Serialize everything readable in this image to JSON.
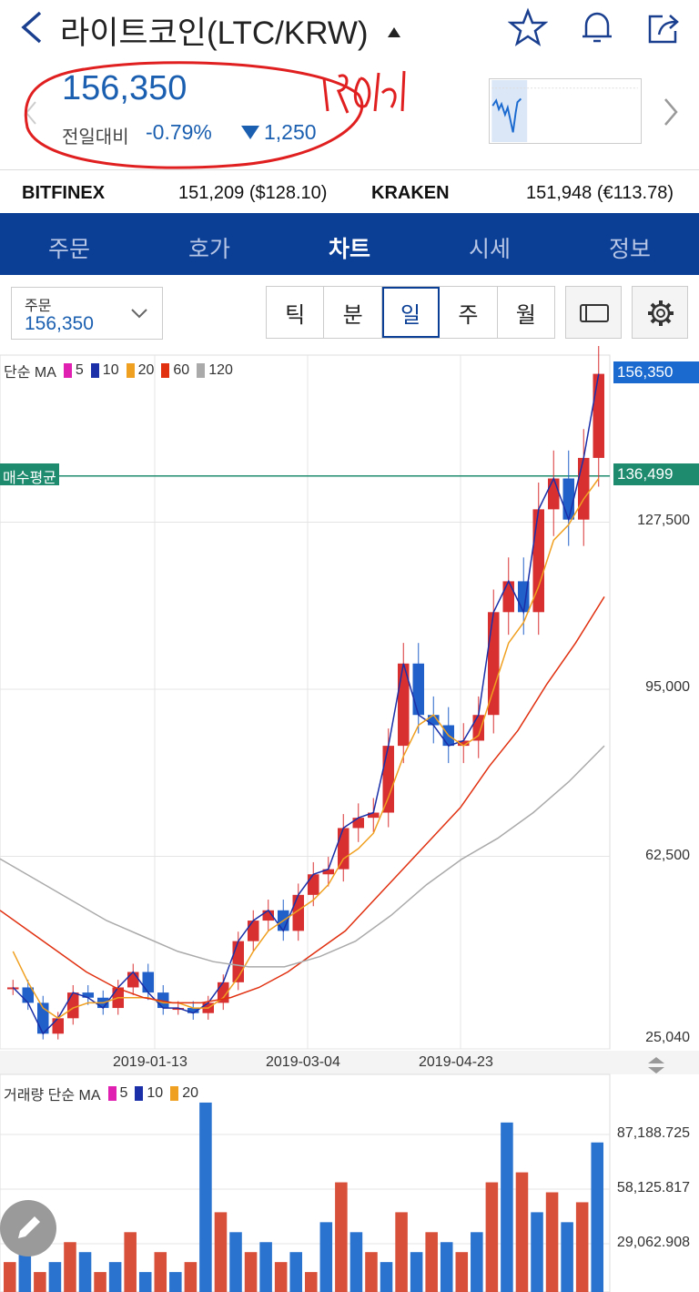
{
  "header": {
    "title": "라이트코인(LTC/KRW)",
    "icons": [
      "back-icon",
      "dropdown-caret-icon",
      "star-icon",
      "bell-icon",
      "share-icon"
    ]
  },
  "price": {
    "current": "156,350",
    "prev_label": "전일대비",
    "change_pct": "-0.79%",
    "change_abs": "1,250",
    "handwritten_note": "190611"
  },
  "exchanges": {
    "bitfinex_name": "BITFINEX",
    "bitfinex_value": "151,209 ($128.10)",
    "kraken_name": "KRAKEN",
    "kraken_value": "151,948 (€113.78)"
  },
  "tabs": [
    {
      "label": "주문"
    },
    {
      "label": "호가"
    },
    {
      "label": "차트"
    },
    {
      "label": "시세"
    },
    {
      "label": "정보"
    }
  ],
  "controls": {
    "order_label": "주문",
    "order_value": "156,350",
    "periods": [
      "틱",
      "분",
      "일",
      "주",
      "월"
    ],
    "selected_period": "일"
  },
  "chart": {
    "ma_label": "단순 MA",
    "ma_periods": [
      "5",
      "10",
      "20",
      "60",
      "120"
    ],
    "ma_colors": [
      "#e020b0",
      "#1a2fa8",
      "#f0a020",
      "#e03010",
      "#aaaaaa"
    ],
    "current_tag": "156,350",
    "avg_label": "매수평균",
    "avg_tag": "136,499",
    "price_levels": [
      "127,500",
      "95,000",
      "62,500",
      "25,040"
    ],
    "dates": [
      "2019-01-13",
      "2019-03-04",
      "2019-04-23"
    ],
    "volume_label": "거래량 단순 MA",
    "volume_periods": [
      "5",
      "10",
      "20"
    ],
    "volume_colors": [
      "#e020b0",
      "#1a2fa8",
      "#f0a020"
    ],
    "volume_levels": [
      "87,188.725",
      "58,125.817",
      "29,062.908"
    ]
  },
  "chart_data": {
    "type": "line",
    "ylim": [
      25040,
      160000
    ],
    "y_ticks": [
      25040,
      62500,
      95000,
      127500
    ],
    "x_tick_labels": [
      "2019-01-13",
      "2019-03-04",
      "2019-04-23"
    ],
    "series": [
      {
        "name": "5",
        "values": [
          37000,
          34000,
          28000,
          31000,
          36000,
          35000,
          33000,
          37000,
          40000,
          36000,
          33000,
          33000,
          32000,
          34000,
          38000,
          46000,
          50000,
          52000,
          48000,
          55000,
          59000,
          60000,
          68000,
          70000,
          71000,
          84000,
          100000,
          90000,
          88000,
          84000,
          85000,
          90000,
          110000,
          116000,
          110000,
          130000,
          136000,
          128000,
          140000,
          156350
        ]
      },
      {
        "name": "20",
        "values": [
          44000,
          38000,
          33000,
          31000,
          33000,
          34000,
          34000,
          35000,
          35000,
          35000,
          34000,
          34000,
          33000,
          33000,
          35000,
          39000,
          44000,
          48000,
          50000,
          52000,
          54000,
          57000,
          62000,
          64000,
          67000,
          74000,
          82000,
          88000,
          90000,
          86000,
          84000,
          86000,
          95000,
          104000,
          108000,
          115000,
          124000,
          127000,
          132000,
          136000
        ]
      }
    ]
  }
}
